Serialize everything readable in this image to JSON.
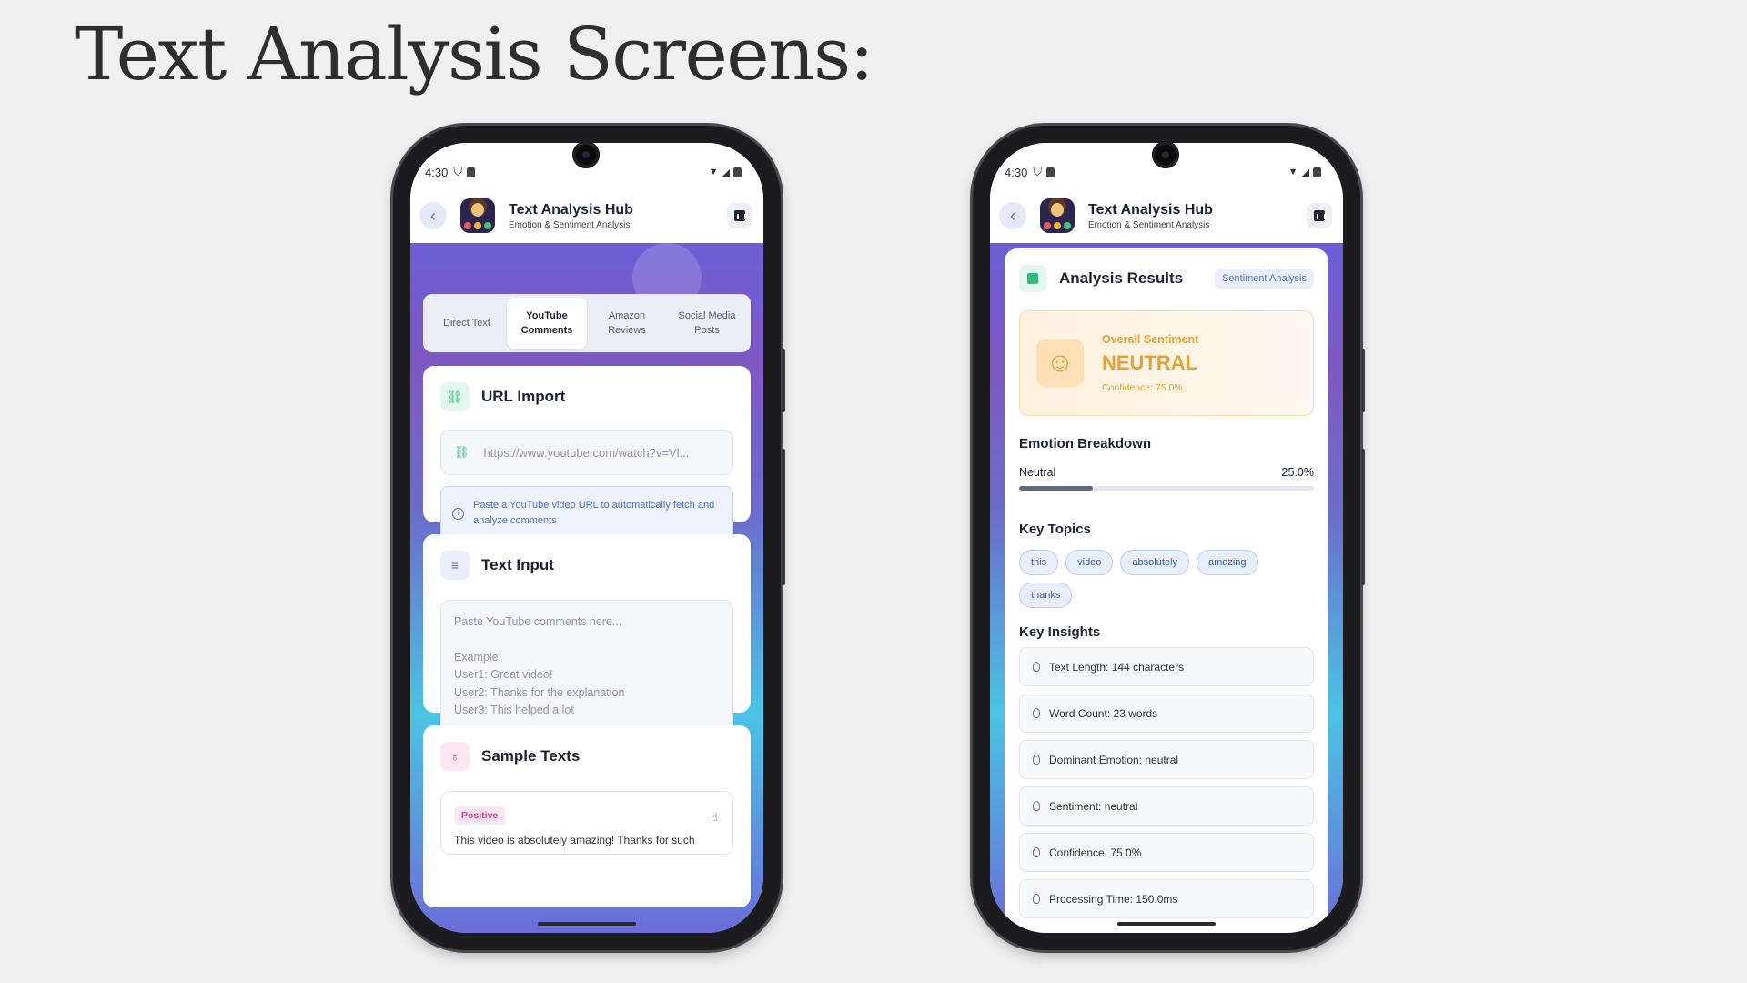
{
  "slide": {
    "title": "Text Analysis Screens:"
  },
  "status_bar": {
    "time": "4:30"
  },
  "app_bar": {
    "title": "Text Analysis Hub",
    "subtitle": "Emotion & Sentiment Analysis"
  },
  "left_screen": {
    "tabs": [
      {
        "label": "Direct Text",
        "active": false
      },
      {
        "label": "YouTube Comments",
        "active": true
      },
      {
        "label": "Amazon Reviews",
        "active": false
      },
      {
        "label": "Social Media Posts",
        "active": false
      }
    ],
    "url_import": {
      "title": "URL Import",
      "placeholder": "https://www.youtube.com/watch?v=Vl...",
      "hint": "Paste a YouTube video URL to automatically fetch and analyze comments"
    },
    "text_input": {
      "title": "Text Input",
      "placeholder_lines": [
        "Paste YouTube comments here...",
        "",
        "Example:",
        "User1: Great video!",
        "User2: Thanks for the explanation",
        "User3: This helped a lot"
      ]
    },
    "sample_texts": {
      "title": "Sample Texts",
      "badge": "Positive",
      "text": "This video is absolutely amazing! Thanks for such"
    }
  },
  "right_screen": {
    "title": "Analysis Results",
    "tag": "Sentiment Analysis",
    "overall": {
      "label": "Overall Sentiment",
      "value": "NEUTRAL",
      "confidence": "Confidence: 75.0%"
    },
    "emotion_breakdown": {
      "title": "Emotion Breakdown",
      "items": [
        {
          "name": "Neutral",
          "value": "25.0%",
          "fraction": 0.25
        }
      ]
    },
    "key_topics": {
      "title": "Key Topics",
      "topics": [
        "this",
        "video",
        "absolutely",
        "amazing",
        "thanks"
      ]
    },
    "key_insights": {
      "title": "Key Insights",
      "items": [
        "Text Length: 144 characters",
        "Word Count: 23 words",
        "Dominant Emotion: neutral",
        "Sentiment: neutral",
        "Confidence: 75.0%",
        "Processing Time: 150.0ms"
      ]
    }
  },
  "colors": {
    "accent": "#6a6fcc",
    "neutral": "#e5a236",
    "positive": "#d0458c"
  }
}
